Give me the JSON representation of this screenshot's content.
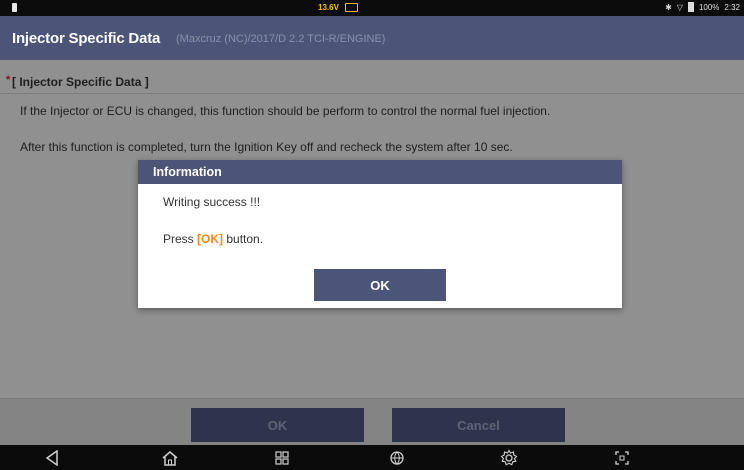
{
  "status_bar": {
    "voltage": "13.6V",
    "battery_percent": "100%",
    "time": "2:32",
    "icons": [
      "bluetooth-icon",
      "wifi-icon",
      "battery-icon"
    ]
  },
  "title_bar": {
    "title": "Injector Specific Data",
    "subtitle": "(Maxcruz (NC)/2017/D 2.2 TCI-R/ENGINE)"
  },
  "section": {
    "bullet": "*",
    "title": "[ Injector Specific Data ]"
  },
  "description": {
    "line1": "If the Injector or ECU is changed, this function should be perform to control the normal fuel injection.",
    "line2": "After this function is completed, turn the Ignition Key off and recheck the system after 10 sec."
  },
  "dialog": {
    "title": "Information",
    "message1": "Writing success !!!",
    "message2_prefix": "Press ",
    "message2_highlight": "[OK]",
    "message2_suffix": " button.",
    "ok_label": "OK"
  },
  "bottom_buttons": {
    "ok_label": "OK",
    "cancel_label": "Cancel"
  },
  "nav_bar": {
    "icons": [
      "back-icon",
      "home-icon",
      "recents-icon",
      "browser-icon",
      "settings-icon",
      "screenshot-icon"
    ]
  },
  "colors": {
    "header": "#4c5477",
    "button": "#4b5479",
    "highlight": "#f08a1c"
  }
}
